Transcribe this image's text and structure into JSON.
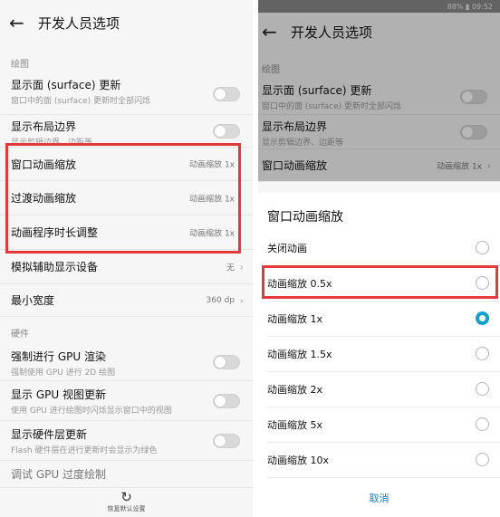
{
  "left": {
    "header": {
      "back_icon": "arrow-left-icon",
      "title": "开发人员选项"
    },
    "section_drawing": "绘图",
    "items": [
      {
        "label": "显示面 (surface) 更新",
        "sub": "窗口中的面 (surface) 更新时全部闪烁",
        "type": "toggle",
        "on": false
      },
      {
        "label": "显示布局边界",
        "sub": "显示剪辑边界、边距等",
        "type": "toggle",
        "on": false
      },
      {
        "label": "窗口动画缩放",
        "value": "动画缩放 1x",
        "type": "value"
      },
      {
        "label": "过渡动画缩放",
        "value": "动画缩放 1x",
        "type": "value"
      },
      {
        "label": "动画程序时长调整",
        "value": "动画缩放 1x",
        "type": "value"
      },
      {
        "label": "模拟辅助显示设备",
        "value": "无",
        "type": "chevron"
      },
      {
        "label": "最小宽度",
        "value": "360 dp",
        "type": "chevron"
      }
    ],
    "section_hardware": "硬件",
    "hw_items": [
      {
        "label": "强制进行 GPU 渲染",
        "sub": "强制使用 GPU 进行 2D 绘图",
        "on": false
      },
      {
        "label": "显示 GPU 视图更新",
        "sub": "使用 GPU 进行绘图时闪烁显示窗口中的视图",
        "on": false
      },
      {
        "label": "显示硬件层更新",
        "sub": "Flash 硬件层在进行更新时会显示为绿色",
        "on": false
      },
      {
        "label": "调试 GPU 过度绘制",
        "sub": "",
        "on": false
      }
    ],
    "footer": {
      "icon": "reset-icon",
      "label": "恢复默认设置"
    }
  },
  "right": {
    "status": "88% ▮ 09:52",
    "header": {
      "back_icon": "arrow-left-icon",
      "title": "开发人员选项"
    },
    "section_drawing": "绘图",
    "items": [
      {
        "label": "显示面 (surface) 更新",
        "sub": "窗口中的面 (surface) 更新时全部闪烁"
      },
      {
        "label": "显示布局边界",
        "sub": "显示剪辑边界、边距等"
      },
      {
        "label": "窗口动画缩放",
        "value": "动画缩放 1x"
      }
    ],
    "dialog": {
      "title": "窗口动画缩放",
      "options": [
        {
          "label": "关闭动画",
          "selected": false
        },
        {
          "label": "动画缩放 0.5x",
          "selected": false
        },
        {
          "label": "动画缩放 1x",
          "selected": true
        },
        {
          "label": "动画缩放 1.5x",
          "selected": false
        },
        {
          "label": "动画缩放 2x",
          "selected": false
        },
        {
          "label": "动画缩放 5x",
          "selected": false
        },
        {
          "label": "动画缩放 10x",
          "selected": false
        }
      ],
      "cancel": "取消"
    }
  },
  "colors": {
    "highlight": "#e23a3a",
    "accent": "#10a0c8",
    "link": "#1a7fd0"
  }
}
